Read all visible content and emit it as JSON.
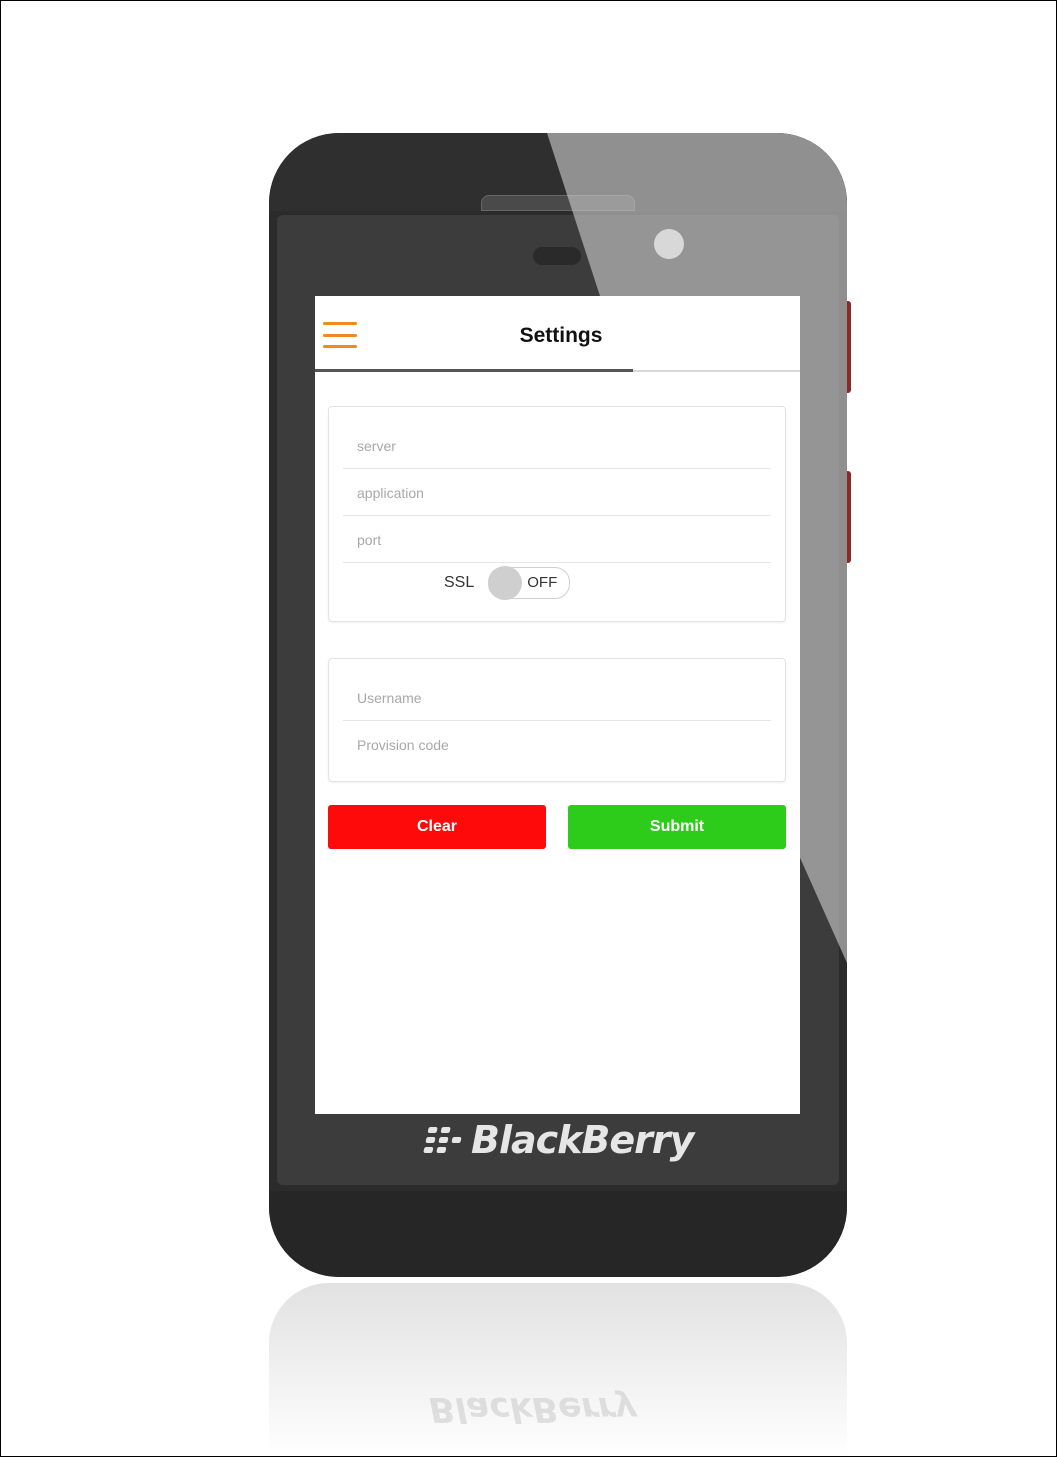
{
  "app": {
    "title": "Settings",
    "brand": "BlackBerry"
  },
  "server_settings": {
    "server_placeholder": "server",
    "application_placeholder": "application",
    "port_placeholder": "port",
    "ssl_label": "SSL",
    "ssl_state": "OFF"
  },
  "credentials": {
    "username_placeholder": "Username",
    "provision_placeholder": "Provision code"
  },
  "actions": {
    "clear_label": "Clear",
    "submit_label": "Submit"
  },
  "colors": {
    "menu_accent": "#f08a1c",
    "clear": "#ff0a0a",
    "submit": "#2ecc1a"
  },
  "icons": {
    "menu": "hamburger-menu-icon",
    "brand": "blackberry-logo-icon"
  }
}
